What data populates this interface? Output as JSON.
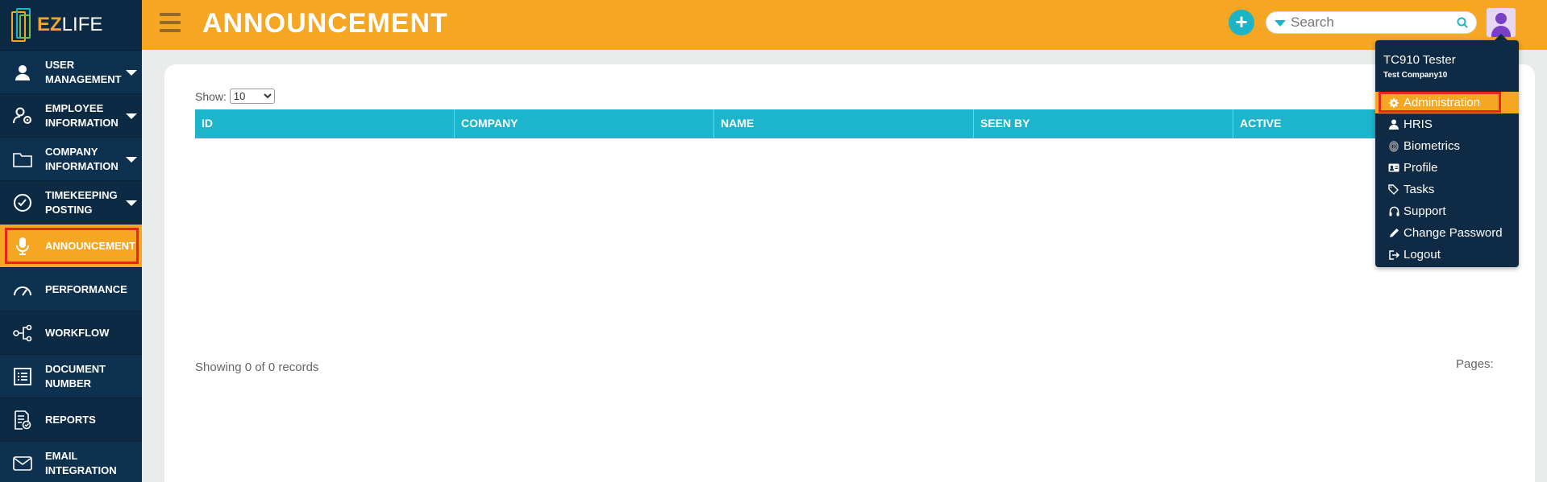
{
  "app": {
    "logo_ez": "EZ",
    "logo_life": "LIFE"
  },
  "header": {
    "title": "ANNOUNCEMENT",
    "search_placeholder": "Search"
  },
  "sidebar": {
    "items": [
      {
        "label": "USER MANAGEMENT",
        "icon": "user-icon",
        "has_caret": true
      },
      {
        "label": "EMPLOYEE INFORMATION",
        "icon": "employee-gear-icon",
        "has_caret": true
      },
      {
        "label": "COMPANY INFORMATION",
        "icon": "folder-icon",
        "has_caret": true
      },
      {
        "label": "TIMEKEEPING POSTING",
        "icon": "check-circle-icon",
        "has_caret": true
      },
      {
        "label": "ANNOUNCEMENT",
        "icon": "microphone-icon",
        "active": true
      },
      {
        "label": "PERFORMANCE",
        "icon": "gauge-icon"
      },
      {
        "label": "WORKFLOW",
        "icon": "workflow-icon"
      },
      {
        "label": "DOCUMENT NUMBER",
        "icon": "list-icon"
      },
      {
        "label": "REPORTS",
        "icon": "report-icon"
      },
      {
        "label": "EMAIL INTEGRATION",
        "icon": "envelope-icon"
      }
    ]
  },
  "content": {
    "show_label": "Show:",
    "show_value": "10",
    "columns": [
      "ID",
      "COMPANY",
      "NAME",
      "SEEN BY",
      "ACTIVE"
    ],
    "records_text": "Showing 0 of 0 records",
    "pages_label": "Pages:"
  },
  "user_menu": {
    "user_name": "TC910 Tester",
    "company": "Test Company10",
    "items": [
      {
        "label": "Administration",
        "icon": "gear-icon",
        "active": true
      },
      {
        "label": "HRIS",
        "icon": "user-icon"
      },
      {
        "label": "Biometrics",
        "icon": "fingerprint-icon"
      },
      {
        "label": "Profile",
        "icon": "id-card-icon"
      },
      {
        "label": "Tasks",
        "icon": "tags-icon"
      },
      {
        "label": "Support",
        "icon": "headphones-icon"
      },
      {
        "label": "Change Password",
        "icon": "pencil-icon"
      },
      {
        "label": "Logout",
        "icon": "logout-icon"
      }
    ]
  },
  "colors": {
    "accent": "#f5a623",
    "sidebar": "#0d2a45",
    "table_header": "#1cb5cb",
    "highlight": "#e8231a"
  }
}
